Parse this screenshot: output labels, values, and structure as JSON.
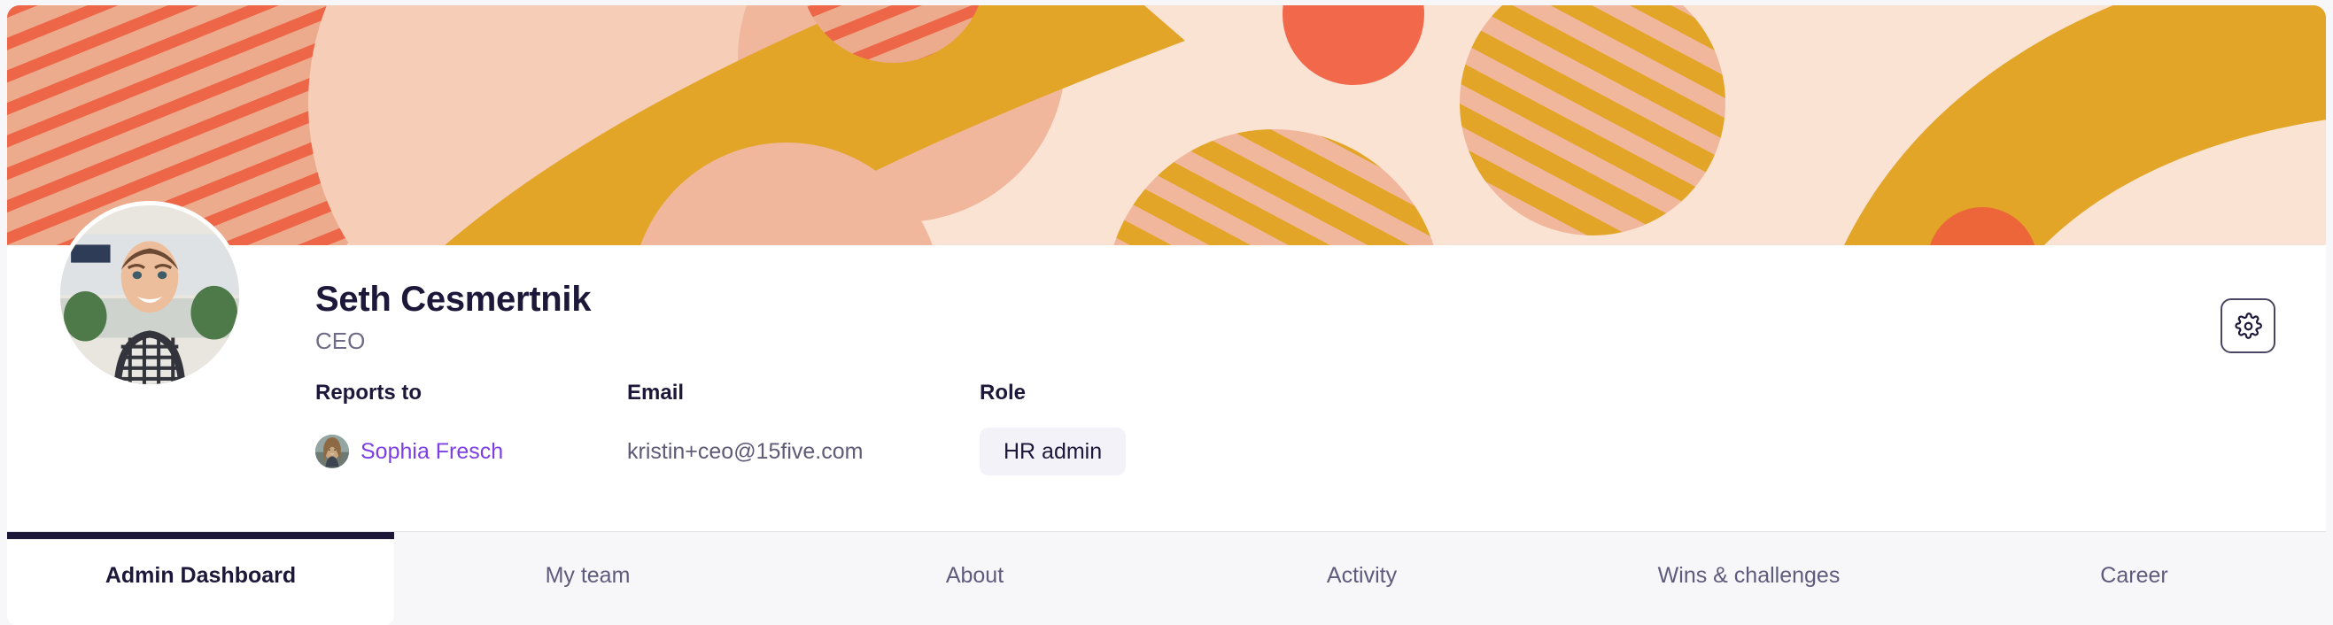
{
  "profile": {
    "name": "Seth Cesmertnik",
    "job_title": "CEO",
    "avatar_icon": "user-photo-avatar",
    "fields": [
      {
        "label": "Reports to",
        "value": "Sophia Fresch",
        "kind": "link",
        "avatar_icon": "manager-photo-avatar"
      },
      {
        "label": "Email",
        "value": "kristin+ceo@15five.com",
        "kind": "text"
      },
      {
        "label": "Role",
        "value": "HR admin",
        "kind": "badge"
      }
    ]
  },
  "settings_button": {
    "icon": "gear-icon",
    "tooltip": "Settings"
  },
  "tabs": [
    {
      "label": "Admin Dashboard",
      "active": true
    },
    {
      "label": "My team",
      "active": false
    },
    {
      "label": "About",
      "active": false
    },
    {
      "label": "Activity",
      "active": false
    },
    {
      "label": "Wins & challenges",
      "active": false
    },
    {
      "label": "Career",
      "active": false
    }
  ],
  "colors": {
    "page_background": "#f7f6f8",
    "card_background": "#ffffff",
    "ink": "#1d1739",
    "muted_ink": "#6f6b87",
    "tab_ink": "#5f5b7d",
    "link": "#7b3fe4",
    "badge_background": "#f4f2f9",
    "banner_base": "#fbe3d3",
    "banner_salmon": "#edab8d",
    "banner_peach": "#f3bda2",
    "banner_coral": "#ef5a3c",
    "banner_amber": "#e2a528"
  }
}
